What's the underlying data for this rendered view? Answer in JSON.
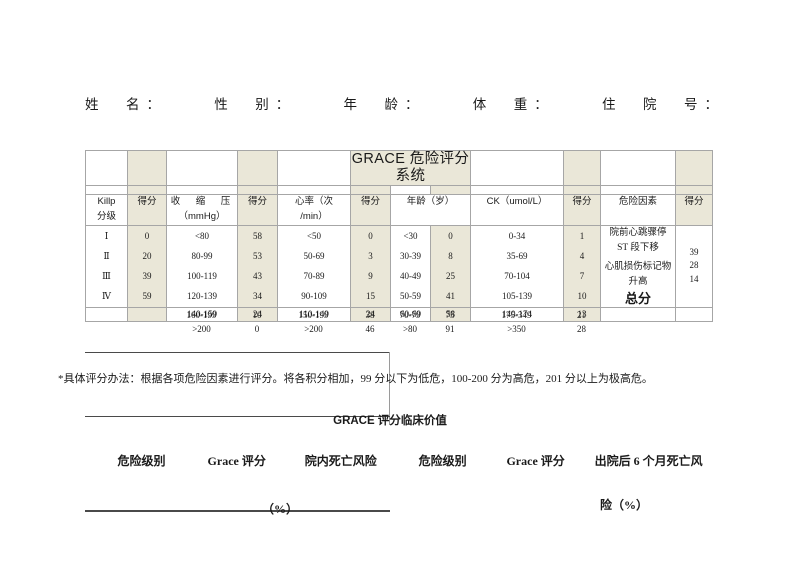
{
  "patient_fields": [
    "姓　名：",
    "性　别：",
    "年　龄：",
    "体　重：",
    "住　院　号："
  ],
  "table": {
    "title": "GRACE 危险评分系统",
    "headers": {
      "killip": "Killp",
      "killip_sub": "分级",
      "score": "得分",
      "sbp": "收　缩　压",
      "sbp_unit": "（mmHg）",
      "hr": "心率（次",
      "hr_unit": "/min）",
      "age": "年龄（岁）",
      "ck": "CK（umol/L）",
      "risk_factor": "危险因素"
    },
    "rows": [
      {
        "killip": "Ⅰ",
        "killip_score": "0",
        "sbp": "<80",
        "sbp_score": "58",
        "hr": "<50",
        "hr_score": "0",
        "age": "<30",
        "age_score": "0",
        "ck": "0-34",
        "ck_score": "1"
      },
      {
        "killip": "Ⅱ",
        "killip_score": "20",
        "sbp": "80-99",
        "sbp_score": "53",
        "hr": "50-69",
        "hr_score": "3",
        "age": "30-39",
        "age_score": "8",
        "ck": "35-69",
        "ck_score": "4"
      },
      {
        "killip": "Ⅲ",
        "killip_score": "39",
        "sbp": "100-119",
        "sbp_score": "43",
        "hr": "70-89",
        "hr_score": "9",
        "age": "40-49",
        "age_score": "25",
        "ck": "70-104",
        "ck_score": "7"
      },
      {
        "killip": "Ⅳ",
        "killip_score": "59",
        "sbp": "120-139",
        "sbp_score": "34",
        "hr": "90-109",
        "hr_score": "15",
        "age": "50-59",
        "age_score": "41",
        "ck": "105-139",
        "ck_score": "10"
      },
      {
        "killip": "",
        "killip_score": "",
        "sbp": "140-159",
        "sbp_score": "24",
        "hr": "110-149",
        "hr_score": "24",
        "age": "60-69",
        "age_score": "58",
        "ck": "140-174",
        "ck_score": "13"
      },
      {
        "killip": "",
        "killip_score": "",
        "sbp": "160-199",
        "sbp_score": "10",
        "hr": "150-199",
        "hr_score": "38",
        "age": "70-79",
        "age_score": "75",
        "ck": "175-349",
        "ck_score": "21"
      },
      {
        "killip": "",
        "killip_score": "",
        "sbp": ">200",
        "sbp_score": "0",
        "hr": ">200",
        "hr_score": "46",
        "age": ">80",
        "age_score": "91",
        "ck": ">350",
        "ck_score": "28"
      }
    ],
    "risk_factors": [
      {
        "label": "院前心跳骤停",
        "score": "39"
      },
      {
        "label": "ST 段下移",
        "score": "28"
      },
      {
        "label": "心肌损伤标记物升高",
        "score": "14"
      }
    ],
    "total_label": "总分",
    "total_value": ""
  },
  "note": "*具体评分办法：根据各项危险因素进行评分。将各积分相加，99 分以下为低危，100-200 分为高危，201 分以上为极高危。",
  "clinical_value": {
    "title": "GRACE 评分临床价值",
    "columns": [
      "危险级别",
      "Grace 评分",
      "院内死亡风险",
      "危险级别",
      "Grace 评分",
      "出院后 6 个月死亡风"
    ],
    "pct_left": "（%）",
    "pct_right": "险（%）"
  },
  "colors": {
    "shade": "#eae7d8",
    "border": "#a6a6a6",
    "rule": "#4a4a4a",
    "text": "#1a1a1a"
  }
}
